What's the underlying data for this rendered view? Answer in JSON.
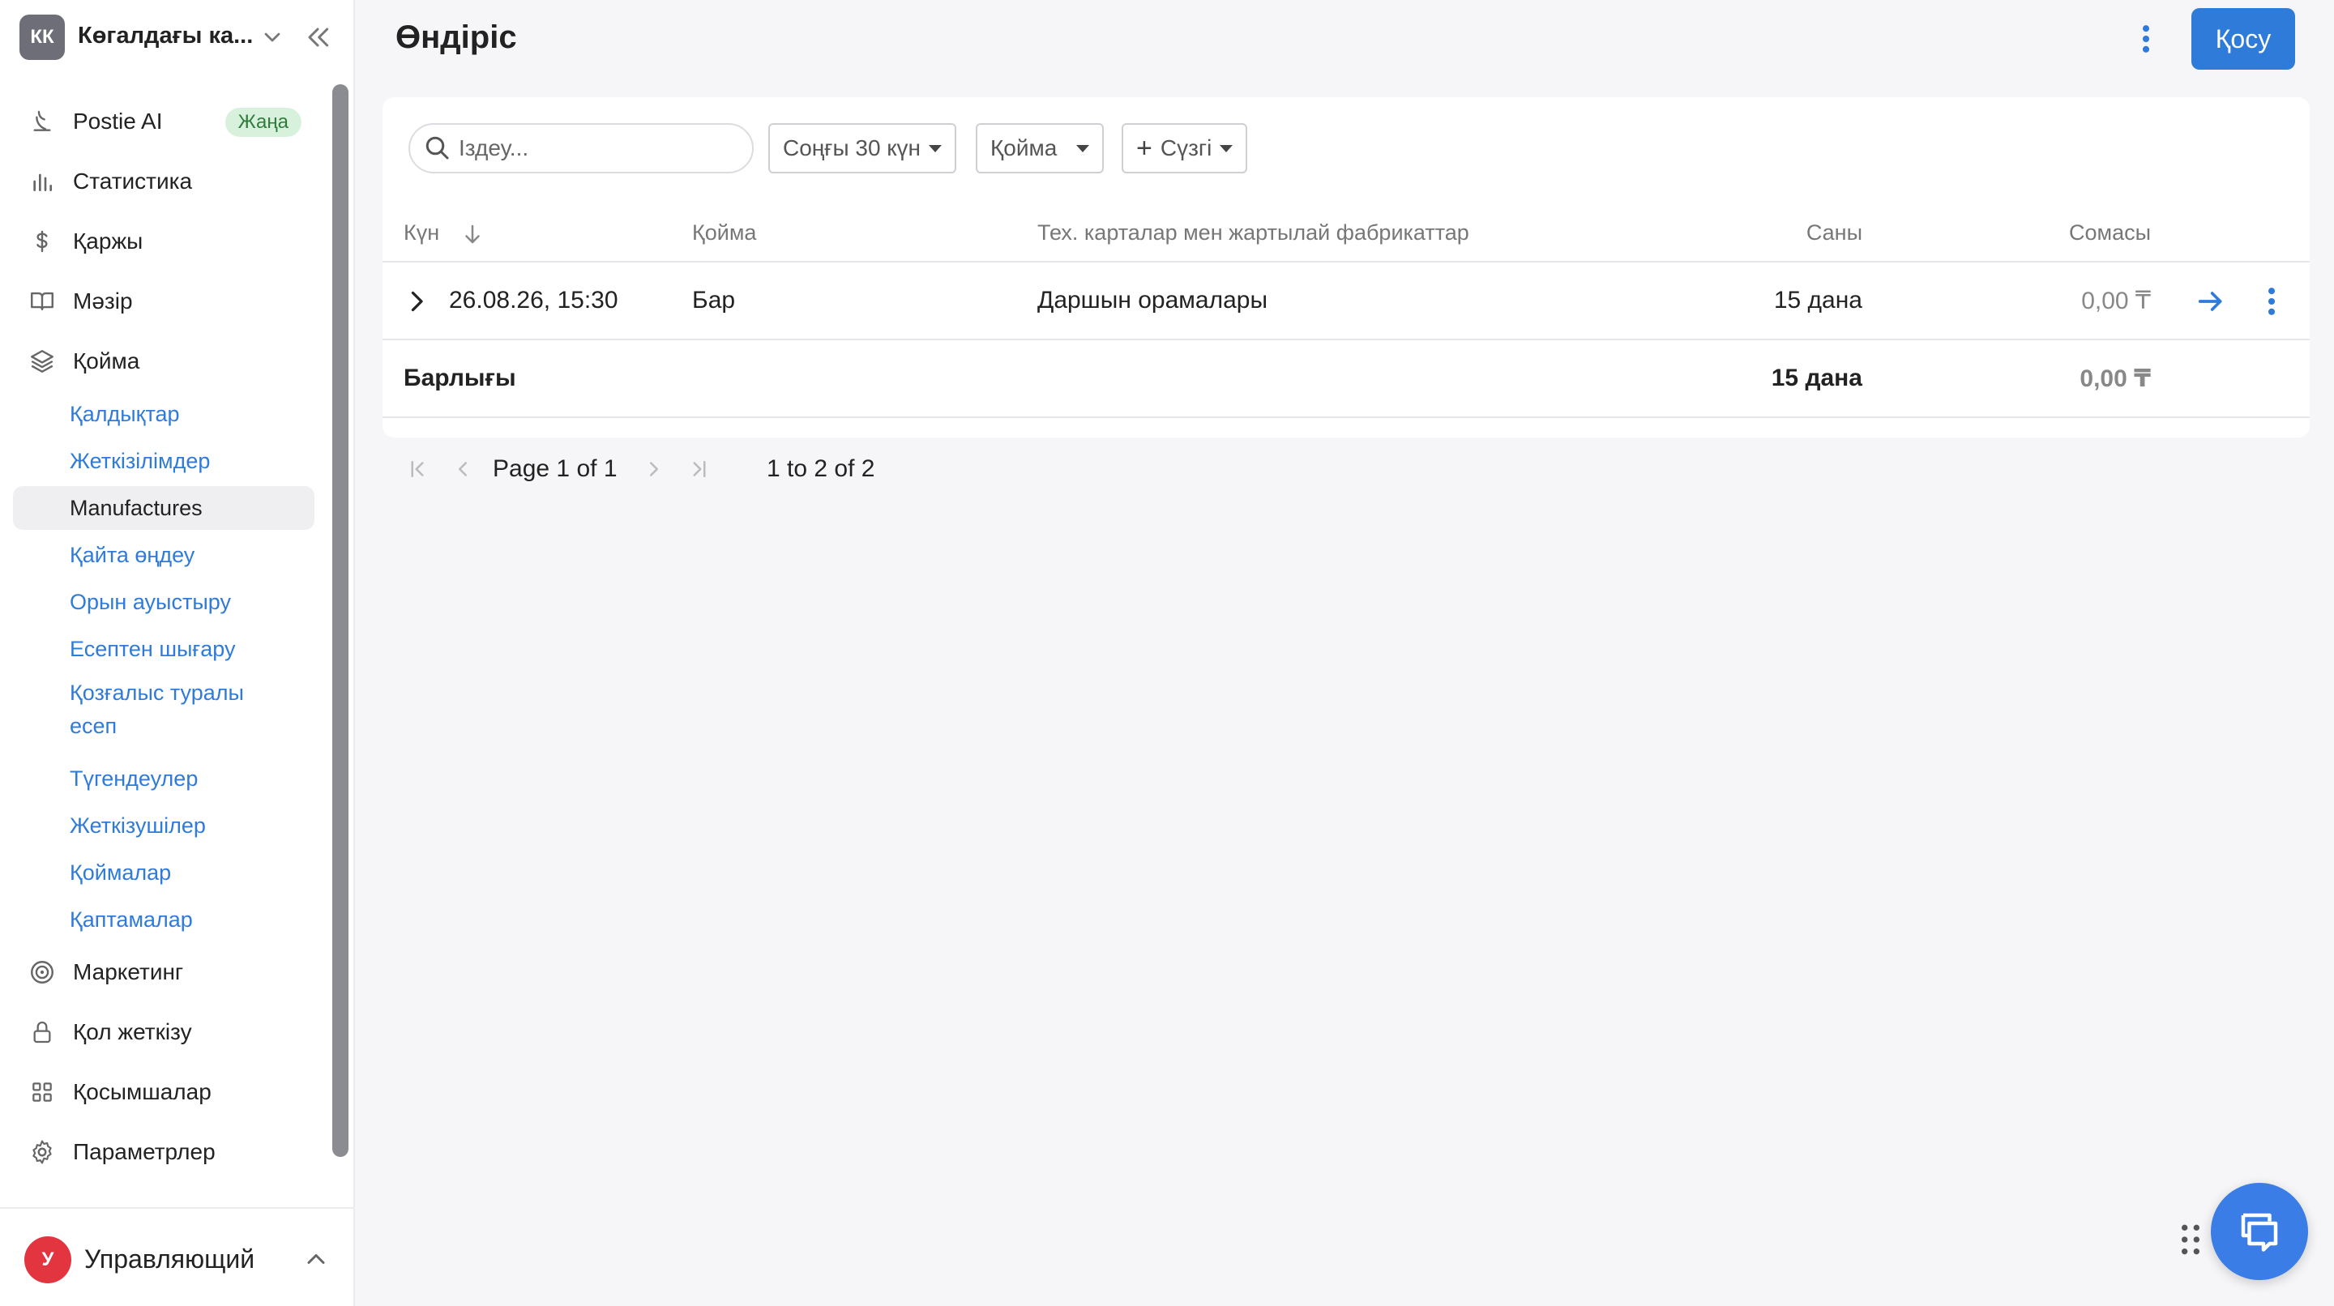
{
  "account": {
    "initials": "КК",
    "name": "Көгалдағы ка..."
  },
  "nav": {
    "postie": "Postie AI",
    "postie_badge": "Жаңа",
    "stats": "Статистика",
    "finance": "Қаржы",
    "menu": "Мәзір",
    "warehouse": "Қойма",
    "warehouse_sub": {
      "stocks": "Қалдықтар",
      "supplies": "Жеткізілімдер",
      "manufactures": "Manufactures",
      "reprocessing": "Қайта өңдеу",
      "transfer": "Орын ауыстыру",
      "writeoff": "Есептен шығару",
      "movement_report": "Қозғалыс туралы есеп",
      "inventory": "Түгендеулер",
      "suppliers": "Жеткізушілер",
      "warehouses": "Қоймалар",
      "packaging": "Қаптамалар"
    },
    "marketing": "Маркетинг",
    "access": "Қол жеткізу",
    "apps": "Қосымшалар",
    "settings": "Параметрлер"
  },
  "user": {
    "initial": "У",
    "name": "Управляющий"
  },
  "header": {
    "title": "Өндіріс",
    "add_label": "Қосу"
  },
  "filters": {
    "search_placeholder": "Іздеу...",
    "period": "Соңғы 30 күн",
    "warehouse": "Қойма",
    "add_filter": "Сүзгі"
  },
  "table": {
    "columns": {
      "date": "Күн",
      "warehouse": "Қойма",
      "items": "Тех. карталар мен жартылай фабрикаттар",
      "quantity": "Саны",
      "amount": "Сомасы"
    },
    "rows": [
      {
        "date": "26.08.26, 15:30",
        "warehouse": "Бар",
        "items": "Даршын орамалары",
        "quantity": "15 дана",
        "amount": "0,00 ₸"
      }
    ],
    "total": {
      "label": "Барлығы",
      "quantity": "15 дана",
      "amount": "0,00 ₸"
    }
  },
  "pagination": {
    "page_word": "Page",
    "page_current": "1",
    "of_word": "of",
    "page_total": "1",
    "range": "1 to 2 of 2"
  },
  "colors": {
    "accent": "#2f7bd9",
    "chat": "#3a7de6",
    "badge_bg": "#d8f1dc",
    "badge_text": "#2f7d3b",
    "user_avatar": "#e2353f"
  },
  "icons": [
    "postie-icon",
    "bar-chart-icon",
    "dollar-icon",
    "book-icon",
    "layers-icon",
    "target-icon",
    "lock-icon",
    "grid-icon",
    "gear-icon",
    "search-icon",
    "sort-down-icon",
    "chevron-right-icon",
    "arrow-right-icon",
    "kebab-icon",
    "chat-icon"
  ]
}
